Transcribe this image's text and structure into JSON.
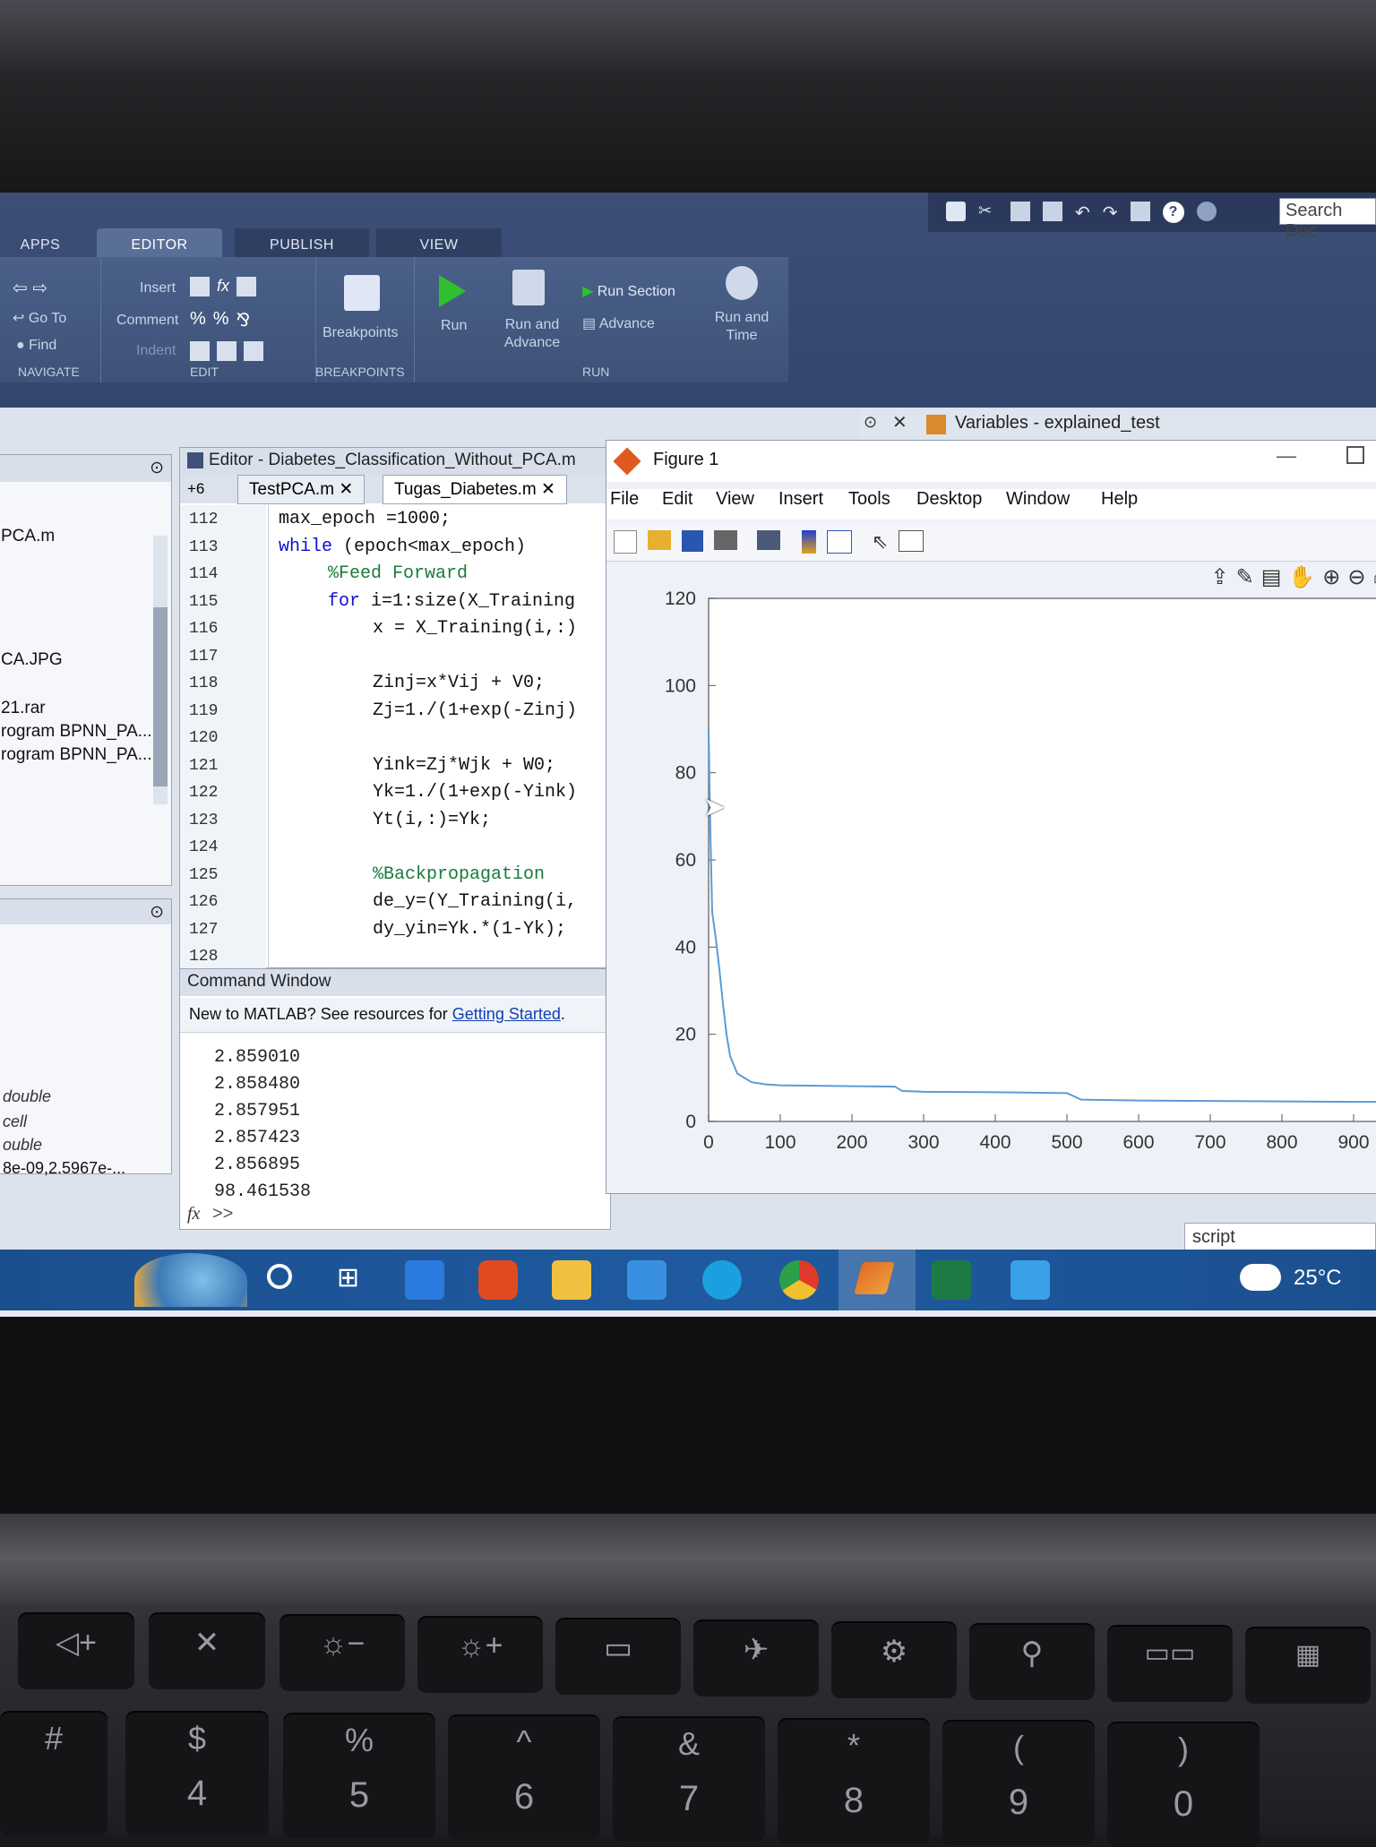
{
  "toolstrip": {
    "tabs": [
      "APPS",
      "EDITOR",
      "PUBLISH",
      "VIEW"
    ],
    "search_placeholder": "Search Doc",
    "navigate": {
      "goto": "Go To",
      "find": "Find",
      "section": "NAVIGATE"
    },
    "edit": {
      "insert": "Insert",
      "comment": "Comment",
      "indent": "Indent",
      "section": "EDIT"
    },
    "breakpoints": {
      "label": "Breakpoints",
      "section": "BREAKPOINTS"
    },
    "run": {
      "run": "Run",
      "run_advance": "Run and Advance",
      "run_section": "Run Section",
      "advance": "Advance",
      "run_time": "Run and Time",
      "section": "RUN"
    }
  },
  "left_panel": {
    "files": [
      "PCA.m",
      "CA.JPG",
      "21.rar",
      "rogram BPNN_PA...",
      "rogram BPNN_PA..."
    ],
    "workspace_types": [
      "double",
      "cell",
      "ouble",
      "8e-09,2.5967e-..."
    ]
  },
  "editor": {
    "title": "Editor - Diabetes_Classification_Without_PCA.m",
    "tab_more": "+6",
    "tabs": [
      "TestPCA.m",
      "Tugas_Diabetes.m"
    ],
    "lines": [
      {
        "n": "112",
        "text": "max_epoch    =1000;"
      },
      {
        "n": "113",
        "kw": "while",
        "text": " (epoch<max_epoch)"
      },
      {
        "n": "114",
        "comment": "%Feed Forward"
      },
      {
        "n": "115",
        "kw": "for",
        "text": " i=1:size(X_Training"
      },
      {
        "n": "116",
        "text": "x = X_Training(i,:)"
      },
      {
        "n": "117",
        "text": ""
      },
      {
        "n": "118",
        "text": "Zinj=x*Vij + V0;"
      },
      {
        "n": "119",
        "text": "Zj=1./(1+exp(-Zinj)"
      },
      {
        "n": "120",
        "text": ""
      },
      {
        "n": "121",
        "text": "Yink=Zj*Wjk + W0;"
      },
      {
        "n": "122",
        "text": "Yk=1./(1+exp(-Yink)"
      },
      {
        "n": "123",
        "text": "Yt(i,:)=Yk;"
      },
      {
        "n": "124",
        "text": ""
      },
      {
        "n": "125",
        "comment": "%Backpropagation"
      },
      {
        "n": "126",
        "text": "de_y=(Y_Training(i,"
      },
      {
        "n": "127",
        "text": "dy_yin=Yk.*(1-Yk);"
      },
      {
        "n": "128",
        "text": ""
      }
    ]
  },
  "command_window": {
    "title": "Command Window",
    "intro": "New to MATLAB? See resources for ",
    "intro_link": "Getting Started",
    "intro_end": ".",
    "outputs": [
      "2.859010",
      "2.858480",
      "2.857951",
      "2.857423",
      "2.856895",
      "98.461538"
    ],
    "prompt": ">>",
    "fx": "fx"
  },
  "variables_tab": {
    "title": "Variables - explained_test"
  },
  "figure": {
    "title": "Figure 1",
    "menu": [
      "File",
      "Edit",
      "View",
      "Insert",
      "Tools",
      "Desktop",
      "Window",
      "Help"
    ]
  },
  "chart_data": {
    "type": "line",
    "title": "",
    "xlabel": "",
    "ylabel": "",
    "xlim": [
      0,
      950
    ],
    "ylim": [
      0,
      120
    ],
    "xticks": [
      0,
      100,
      200,
      300,
      400,
      500,
      600,
      700,
      800,
      900
    ],
    "yticks": [
      0,
      20,
      40,
      60,
      80,
      100,
      120
    ],
    "series": [
      {
        "color": "#5b9bd5",
        "x": [
          0,
          2,
          5,
          10,
          15,
          20,
          25,
          30,
          40,
          50,
          60,
          80,
          100,
          150,
          200,
          260,
          270,
          300,
          400,
          500,
          520,
          600,
          700,
          800,
          900,
          950
        ],
        "y": [
          90,
          70,
          48,
          42,
          35,
          27,
          20,
          15,
          11,
          10,
          9,
          8.5,
          8.3,
          8.2,
          8.1,
          8,
          7,
          6.8,
          6.7,
          6.5,
          5,
          4.8,
          4.7,
          4.6,
          4.5,
          4.5
        ]
      }
    ]
  },
  "taskbar": {
    "weather": "25°C",
    "search_box": "script"
  }
}
